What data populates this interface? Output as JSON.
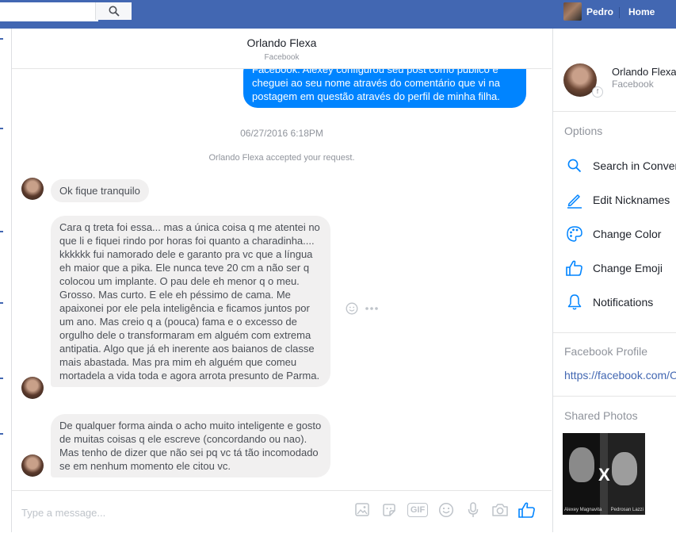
{
  "topbar": {
    "search_placeholder": "",
    "user_name": "Pedro",
    "home_label": "Home",
    "brand_color": "#4267b2"
  },
  "conversation": {
    "title": "Orlando Flexa",
    "subtitle": "Facebook",
    "outgoing_message": "Facebook. Alexey  configurou seu post como público e cheguei ao seu nome através do comentário que vi na postagem em questão através do perfil de minha filha.",
    "timestamp": "06/27/2016 6:18PM",
    "system_note": "Orlando Flexa accepted your request.",
    "incoming": [
      "Ok fique tranquilo",
      "Cara q treta foi essa... mas a única coisa q me atentei no que li e fiquei rindo por horas foi quanto a charadinha.... kkkkkk fui namorado dele e garanto pra vc que a língua eh maior que a pika. Ele nunca teve 20 cm a não ser q colocou um implante.  O pau dele eh menor q o meu. Grosso. Mas curto. E ele eh péssimo de cama. Me apaixonei por ele pela inteligência e ficamos juntos por um ano. Mas creio q a (pouca) fama e o excesso de orgulho dele o transformaram em alguém com extrema antipatia. Algo que já eh inerente aos baianos de classe mais abastada. Mas pra mim eh alguém que comeu mortadela a vida toda e agora arrota presunto de Parma.",
      "De qualquer forma ainda o acho muito inteligente e gosto de muitas coisas q ele escreve (concordando ou nao). Mas tenho de dizer que não sei pq vc tá tão incomodado se em nenhum momento ele citou vc."
    ],
    "accent_color": "#0084ff"
  },
  "composer": {
    "placeholder": "Type a message...",
    "gif_label": "GIF"
  },
  "panel": {
    "contact_name": "Orlando Flexa",
    "contact_sub": "Facebook",
    "options_heading": "Options",
    "items": [
      {
        "label": "Search in Conversation",
        "icon": "search-icon"
      },
      {
        "label": "Edit Nicknames",
        "icon": "pencil-icon"
      },
      {
        "label": "Change Color",
        "icon": "palette-icon"
      },
      {
        "label": "Change Emoji",
        "icon": "thumbs-up-icon"
      },
      {
        "label": "Notifications",
        "icon": "bell-icon"
      }
    ],
    "profile_heading": "Facebook Profile",
    "profile_link": "https://facebook.com/O",
    "photos_heading": "Shared Photos",
    "photo_caption_left": "Alexey Magnavita",
    "photo_caption_right": "Pedrosan Lazzi"
  }
}
